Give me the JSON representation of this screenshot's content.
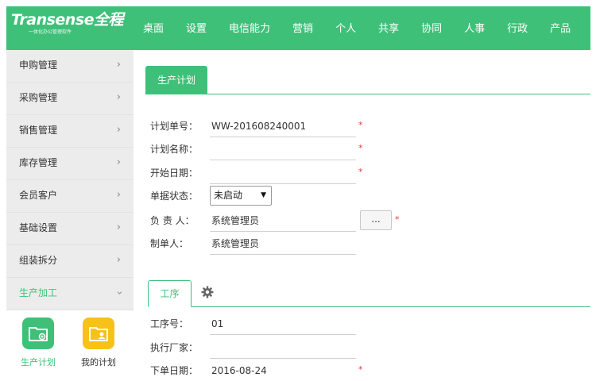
{
  "brand": {
    "name": "Transense全程",
    "tagline": "一体化办公管理软件"
  },
  "top_nav": [
    {
      "label": "桌面"
    },
    {
      "label": "设置"
    },
    {
      "label": "电信能力"
    },
    {
      "label": "营销"
    },
    {
      "label": "个人"
    },
    {
      "label": "共享"
    },
    {
      "label": "协同"
    },
    {
      "label": "人事"
    },
    {
      "label": "行政"
    },
    {
      "label": "产品"
    }
  ],
  "sidebar": {
    "items": [
      {
        "label": "申购管理"
      },
      {
        "label": "采购管理"
      },
      {
        "label": "销售管理"
      },
      {
        "label": "库存管理"
      },
      {
        "label": "会员客户"
      },
      {
        "label": "基础设置"
      },
      {
        "label": "组装拆分"
      },
      {
        "label": "生产加工"
      }
    ],
    "apps": [
      {
        "label": "生产计划",
        "color": "#3fc079"
      },
      {
        "label": "我的计划",
        "color": "#f6c21a"
      }
    ]
  },
  "main": {
    "tab_label": "生产计划",
    "form": {
      "plan_no": {
        "label": "计划单号：",
        "value": "WW-201608240001",
        "required": "*"
      },
      "plan_name": {
        "label": "计划名称：",
        "value": "",
        "required": "*"
      },
      "start_date": {
        "label": "开始日期：",
        "value": "",
        "required": "*"
      },
      "status": {
        "label": "单据状态：",
        "value": "未启动"
      },
      "owner": {
        "label": "负 责 人：",
        "value": "系统管理员",
        "button": "...",
        "required": "*"
      },
      "creator": {
        "label": "制单人：",
        "value": "系统管理员"
      }
    },
    "process_tab": "工序",
    "process_form": {
      "process_no": {
        "label": "工序号：",
        "value": "01"
      },
      "vendor": {
        "label": "执行厂家：",
        "value": ""
      },
      "order_date": {
        "label": "下单日期：",
        "value": "2016-08-24",
        "required": "*"
      }
    }
  },
  "colors": {
    "accent": "#3fc079",
    "required": "#e23b3b",
    "sidebar_bg": "#ececec"
  }
}
